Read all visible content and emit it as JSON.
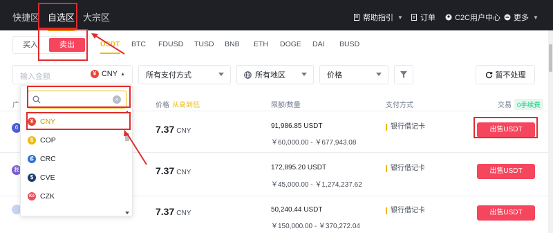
{
  "nav": {
    "tabs": [
      "快捷区",
      "自选区",
      "大宗区"
    ],
    "active_tab": "自选区",
    "right": {
      "help": "帮助指引",
      "orders": "订单",
      "c2c": "C2C用户中心",
      "more": "更多"
    }
  },
  "trade": {
    "buy": "买入",
    "sell": "卖出"
  },
  "coins": [
    "USDT",
    "BTC",
    "FDUSD",
    "TUSD",
    "BNB",
    "ETH",
    "DOGE",
    "DAI",
    "BUSD"
  ],
  "active_coin": "USDT",
  "filters": {
    "amount_placeholder": "输入金额",
    "currency": "CNY",
    "payment": "所有支付方式",
    "region": "所有地区",
    "price": "价格",
    "refresh": "暂不处理"
  },
  "dropdown": {
    "search_value": "",
    "options": [
      {
        "code": "CNY",
        "symbol": "¥",
        "color": "#e8463c"
      },
      {
        "code": "COP",
        "symbol": "$",
        "color": "#f0b90b"
      },
      {
        "code": "CRC",
        "symbol": "₡",
        "color": "#2f6fd6"
      },
      {
        "code": "CVE",
        "symbol": "$",
        "color": "#1f3b6e"
      },
      {
        "code": "CZK",
        "symbol": "Kč",
        "color": "#e8505b"
      }
    ],
    "selected": "CNY"
  },
  "table": {
    "header": {
      "advertiser": "广",
      "price": "价格",
      "sort": "从高到低",
      "limit": "限额/数量",
      "payment": "支付方式",
      "trade": "交易",
      "fee": "0手续费"
    },
    "rows": [
      {
        "avatar": "6",
        "price": "7.37",
        "unit": "CNY",
        "available": "91,986.85 USDT",
        "limit": "￥60,000.00 - ￥677,943.08",
        "payment": "银行借记卡",
        "action": "出售USDT"
      },
      {
        "avatar": "我",
        "price": "7.37",
        "unit": "CNY",
        "available": "172,895.20 USDT",
        "limit": "￥45,000.00 - ￥1,274,237.62",
        "payment": "银行借记卡",
        "action": "出售USDT"
      },
      {
        "avatar": "",
        "price": "7.37",
        "unit": "CNY",
        "available": "50,240.44 USDT",
        "limit": "￥150,000.00 - ￥370,272.04",
        "payment": "银行借记卡",
        "action": "出售USDT"
      }
    ]
  },
  "colors": {
    "accent": "#f0b90b",
    "sell": "#f6465d",
    "nav_bg": "#1e2026",
    "annotation": "#e02c2c"
  }
}
